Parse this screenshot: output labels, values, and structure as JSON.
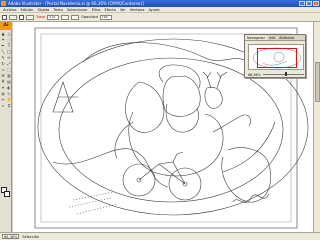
{
  "window": {
    "title": "Adobe Illustrator - [Postal Navidenia.ai @ 66,36% (CMYK/Contorno)]"
  },
  "menubar": [
    "Archivo",
    "Edición",
    "Objeto",
    "Texto",
    "Seleccionar",
    "Filtro",
    "Efecto",
    "Ver",
    "Ventana",
    "Ayuda"
  ],
  "control": {
    "trazo": "Trazo",
    "value": "1 pt",
    "opacidad": "Opacidad",
    "opacity_value": "100"
  },
  "toolbox": {
    "logo": "Ai"
  },
  "navigator": {
    "tabs": [
      "Navegador",
      "Info",
      "Atributos"
    ],
    "zoom": "66,36%"
  },
  "status": {
    "zoom": "66,36%",
    "tool": "Selección"
  }
}
